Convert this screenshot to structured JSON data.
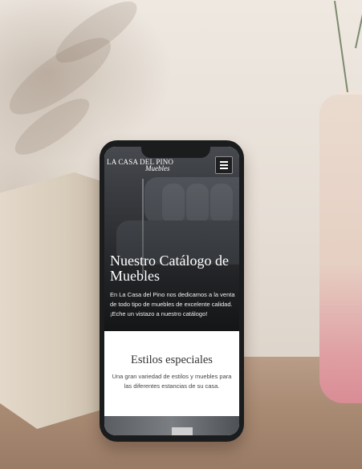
{
  "site": {
    "logo_top": "LA CASA DEL PINO",
    "logo_script": "Muebles",
    "menu_icon": "hamburger-menu-icon"
  },
  "hero": {
    "title": "Nuestro Catálogo de Muebles",
    "text": "En La Casa del Pino nos dedicamos a la venta de todo tipo de muebles de excelente calidad. ¡Eche un vistazo a nuestro catálogo!"
  },
  "styles_section": {
    "title": "Estilos especiales",
    "text": "Una gran variedad de estilos y muebles para las diferentes estancias de su casa."
  },
  "colors": {
    "phone_frame": "#1b1c1e",
    "hero_text": "#ffffff",
    "section_bg": "#ffffff"
  }
}
